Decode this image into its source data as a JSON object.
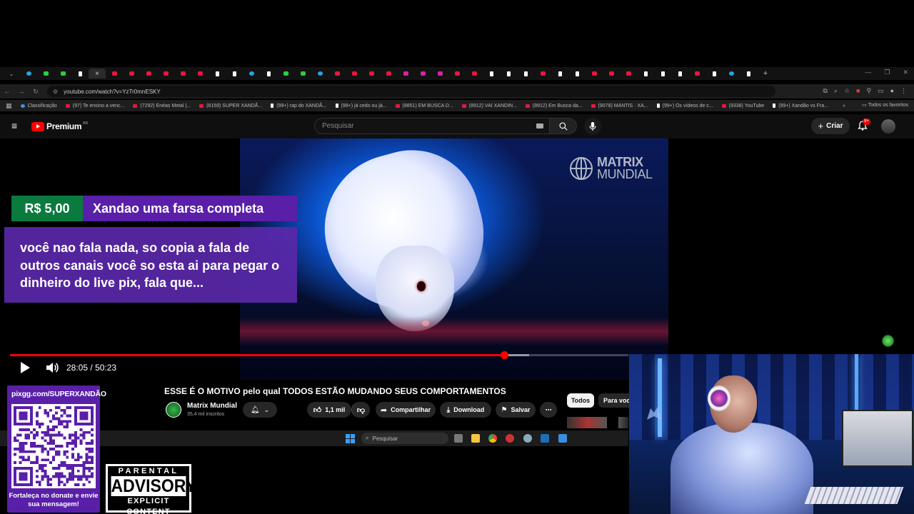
{
  "browser": {
    "active_tab_close": "×",
    "new_tab": "+",
    "url": "youtube.com/watch?v=YzTr0mnESKY",
    "bookmarks": [
      {
        "label": "Classificação",
        "kind": "g"
      },
      {
        "label": "(97) Te ensino a venc...",
        "kind": "yt"
      },
      {
        "label": "(7292) Enéas Metal |...",
        "kind": "yt"
      },
      {
        "label": "(8159) SUPER XANDÃ...",
        "kind": "yt"
      },
      {
        "label": "(99+) rap do XANDÃ...",
        "kind": "tt"
      },
      {
        "label": "(99+) já cedo ou já...",
        "kind": "tt"
      },
      {
        "label": "(8851) EM BUSCA D...",
        "kind": "yt"
      },
      {
        "label": "(8912) VAI XANDIN...",
        "kind": "yt"
      },
      {
        "label": "(8912) Em Busca da...",
        "kind": "yt"
      },
      {
        "label": "(9078) MANTIS · XA...",
        "kind": "yt"
      },
      {
        "label": "(99+) Os vídeos de c...",
        "kind": "tt"
      },
      {
        "label": "(9338) YouTube",
        "kind": "yt"
      },
      {
        "label": "(99+) Xandão vs Fra...",
        "kind": "tt"
      }
    ],
    "all_bookmarks": "Todos os favoritos"
  },
  "youtube": {
    "logo_text": "Premium",
    "logo_region": "BR",
    "search_placeholder": "Pesquisar",
    "create_label": "Criar",
    "notifications_badge": "9+"
  },
  "video": {
    "watermark_line1": "MATRIX",
    "watermark_line2": "MUNDIAL",
    "time_current": "28:05",
    "time_total": "50:23",
    "time_separator": "/",
    "progress_fraction": 0.7996,
    "buffer_fraction": 0.84,
    "title": "ESSE É O MOTIVO pelo qual TODOS ESTÃO MUDANDO SEUS COMPORTAMENTOS",
    "channel": "Matrix Mundial",
    "subscribers": "35,4 mil inscritos",
    "like_count": "1,1 mil",
    "share_label": "Compartilhar",
    "download_label": "Download",
    "save_label": "Salvar"
  },
  "donation": {
    "amount": "R$ 5,00",
    "title": "Xandao uma farsa completa",
    "message": "você nao fala nada, so copia a fala de outros canais você so esta ai para pegar o dinheiro do live pix, fala que..."
  },
  "sidebar_chips": {
    "all": "Todos",
    "for_you": "Para você"
  },
  "taskbar": {
    "search_placeholder": "Pesquisar"
  },
  "stream_overlay": {
    "pix_url": "pixgg.com/SUPERXANDÃO",
    "pix_note": "Fortaleça no donate e envie sua mensagem!",
    "advisory_line1": "PARENTAL",
    "advisory_line2": "ADVISORY",
    "advisory_line3": "EXPLICIT CONTENT"
  },
  "colors": {
    "progress": "#ff0000",
    "donation_green": "#0b7a3e",
    "donation_purple": "#5a1fa8"
  }
}
